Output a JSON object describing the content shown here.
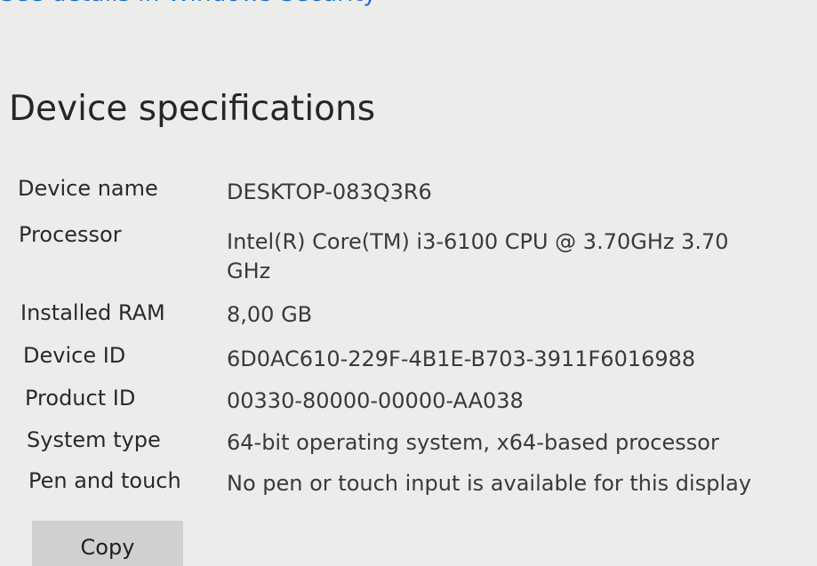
{
  "header": {
    "security_link": "See details in Windows Security"
  },
  "section": {
    "title": "Device specifications"
  },
  "specs": [
    {
      "label": "Device name",
      "value": "DESKTOP-083Q3R6"
    },
    {
      "label": "Processor",
      "value": "Intel(R) Core(TM) i3-6100 CPU @ 3.70GHz   3.70 GHz"
    },
    {
      "label": "Installed RAM",
      "value": "8,00 GB"
    },
    {
      "label": "Device ID",
      "value": "6D0AC610-229F-4B1E-B703-3911F6016988"
    },
    {
      "label": "Product ID",
      "value": "00330-80000-00000-AA038"
    },
    {
      "label": "System type",
      "value": "64-bit operating system, x64-based processor"
    },
    {
      "label": "Pen and touch",
      "value": "No pen or touch input is available for this display"
    }
  ],
  "actions": {
    "copy_label": "Copy"
  },
  "colors": {
    "link": "#1a6fc4",
    "background": "#ececea",
    "button": "#d0d0ce"
  }
}
